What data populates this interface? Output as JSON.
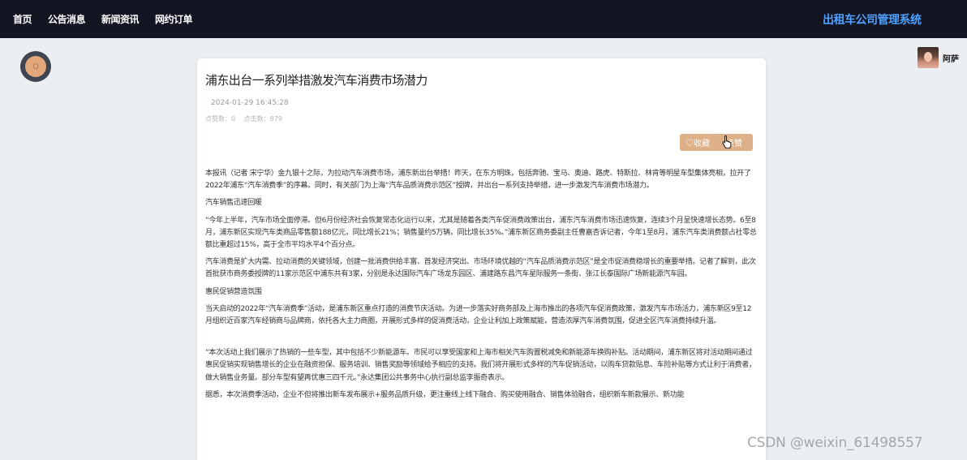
{
  "nav": {
    "items": [
      {
        "label": "首页"
      },
      {
        "label": "公告消息"
      },
      {
        "label": "新闻资讯"
      },
      {
        "label": "网约订单"
      }
    ],
    "brand": "出租车公司管理系统"
  },
  "logo": {
    "glyph": "Q"
  },
  "user": {
    "name": "阿萨"
  },
  "article": {
    "title": "浦东出台一系列举措激发汽车消费市场潜力",
    "date": "2024-01-29 16:45:28",
    "stats": {
      "comments": "点赞数：0",
      "clicks": "点击数：879"
    },
    "buttons": {
      "favorite": "♡收藏",
      "like": "点赞"
    },
    "paragraphs": [
      "本报讯（记者 宋宁华）金九银十之际，为拉动汽车消费市场，浦东新出台举措！昨天，在东方明珠，包括奔驰、宝马、奥迪、路虎、特斯拉、林肯等明星车型集体亮相，拉开了2022年浦东“汽车消费季”的序幕。同时，有关部门为上海“汽车品质消费示范区”授牌，并出台一系列支持举措，进一步激发汽车消费市场潜力。",
      "汽车销售迅速回暖",
      "“今年上半年，汽车市场全面停滞。但6月份经济社会恢复常态化运行以来，尤其是随着各类汽车促消费政策出台，浦东汽车消费市场迅速恢复，连续3个月呈快速增长态势。6至8月，浦东新区实现汽车类商品零售额188亿元，同比增长21%；销售量约5万辆，同比增长35%。”浦东新区商务委副主任曹嘉杏诉记者，今年1至8月，浦东汽车类消费额占社零总额比重超过15%，高于全市平均水平4个百分点。",
      "汽车消费是扩大内需、拉动消费的关键领域，创建一批消费供给丰富、首发经济突出、市场环境优越的“汽车品质消费示范区”是全市促消费稳增长的重要举措。记者了解到，此次首批获市商务委授牌的11家示范区中浦东共有3家，分别是永达国际汽车广场龙东园区、浦建路东昌汽车星际服务一条街、张江长泰国际广场新能源汽车园。",
      "惠民促销营造氛围",
      "当天启动的2022年“汽车消费季”活动，是浦东新区重点打造的消费节庆活动。为进一步落实好商务部及上海市推出的各项汽车促消费政策，激发汽车市场活力，浦东新区9至12月组织近百家汽车经销商与品牌商，依托各大主力商圈，开展形式多样的促消费活动，企业让利加上政策赋能，营造浓厚汽车消费氛围，促进全区汽车消费持续升温。",
      "“本次活动上我们展示了热销的一些车型，其中包括不少新能源车。市民可以享受国家和上海市相关汽车购置税减免和新能源车换购补贴。活动期间，浦东新区将对活动期间通过惠民促销实现销售增长的企业在融资担保、服务培训、销售奖励等领域给予相应的支持。我们将开展形式多样的汽车促销活动，以购车贷款贴息、车险补贴等方式让利于消费者，做大销售业务量。部分车型有望再优惠三四千元。”永达集团公共事务中心执行副总监李振奇表示。",
      "据悉，本次消费季活动，企业不但将推出新车发布展示+服务品质升级，更注重线上线下融合、购买使用融合、销售体验融合，组织新车新款展示、新功能"
    ]
  },
  "watermark": "CSDN @weixin_61498557",
  "colors": {
    "topbar": "#141522",
    "brand": "#4ea1ff",
    "button": "#deb088"
  }
}
